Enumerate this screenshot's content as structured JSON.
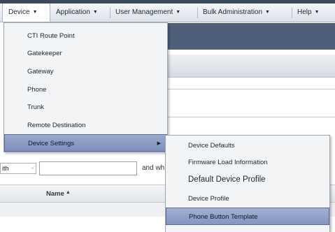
{
  "menubar": {
    "items": [
      {
        "label": "Device"
      },
      {
        "label": "Application"
      },
      {
        "label": "User Management"
      },
      {
        "label": "Bulk Administration"
      },
      {
        "label": "Help"
      }
    ]
  },
  "device_menu": {
    "items": [
      {
        "label": "CTI Route Point"
      },
      {
        "label": "Gatekeeper"
      },
      {
        "label": "Gateway"
      },
      {
        "label": "Phone"
      },
      {
        "label": "Trunk"
      },
      {
        "label": "Remote Destination"
      },
      {
        "label": "Device Settings"
      }
    ]
  },
  "device_settings_menu": {
    "items": [
      {
        "label": "Device Defaults"
      },
      {
        "label": "Firmware Load Information"
      },
      {
        "label": "Default Device Profile"
      },
      {
        "label": "Device Profile"
      },
      {
        "label": "Phone Button Template"
      }
    ]
  },
  "search": {
    "where_value": "ith",
    "and_text": "and wh"
  },
  "table": {
    "col_name": "Name"
  },
  "icons": {
    "caret": "chevron-down-icon",
    "submenu_arrow": "triangle-right-icon",
    "sort": "sort-ascending-icon"
  }
}
